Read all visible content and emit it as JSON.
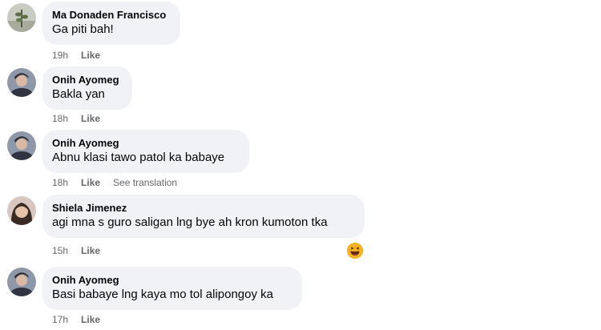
{
  "comments": [
    {
      "author": "Ma Donaden Francisco",
      "text": "Ga piti bah!",
      "time": "19h",
      "like": "Like",
      "avatar_icon": "plant-photo-icon"
    },
    {
      "author": "Onih Ayomeg",
      "text": "Bakla yan",
      "time": "18h",
      "like": "Like",
      "avatar_icon": "profile-photo-icon"
    },
    {
      "author": "Onih Ayomeg",
      "text": "Abnu klasi tawo patol ka babaye",
      "time": "18h",
      "like": "Like",
      "see_translation": "See translation",
      "avatar_icon": "profile-photo-icon"
    },
    {
      "author": "Shiela Jimenez",
      "text": "agi mna s guro saligan lng bye ah kron kumoton tka",
      "time": "15h",
      "like": "Like",
      "reaction": "haha-reaction-icon",
      "avatar_icon": "profile-photo-icon"
    },
    {
      "author": "Onih Ayomeg",
      "text": "Basi babaye lng kaya mo tol alipongoy ka",
      "time": "17h",
      "like": "Like",
      "avatar_icon": "profile-photo-icon"
    }
  ],
  "colors": {
    "bubble": "#f0f2f5",
    "author": "#050505",
    "meta": "#65676b",
    "reaction": "#f7b125"
  }
}
